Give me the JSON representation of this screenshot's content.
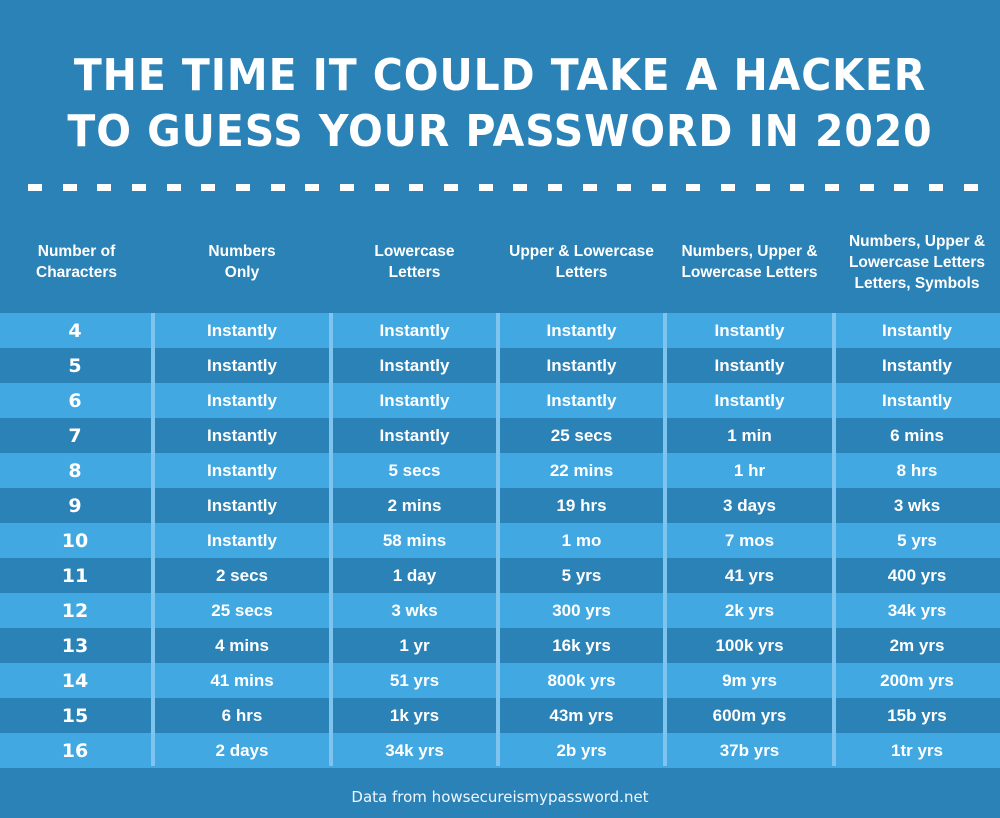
{
  "title_lines": [
    "THE TIME IT COULD TAKE A HACKER",
    "TO GUESS YOUR PASSWORD IN 2020"
  ],
  "footer": "Data from howsecureismypassword.net",
  "colors": {
    "background": "#2b82b6",
    "row_light": "#42a8e2",
    "row_dark": "#2b82b6",
    "divider": "#7ec4ef",
    "text": "#ffffff"
  },
  "chart_data": {
    "type": "table",
    "title": "THE TIME IT COULD TAKE A HACKER TO GUESS YOUR PASSWORD IN 2020",
    "columns": [
      "Number of Characters",
      "Numbers Only",
      "Lowercase Letters",
      "Upper & Lowercase Letters",
      "Numbers, Upper & Lowercase Letters",
      "Numbers, Upper & Lowercase Letters Letters, Symbols"
    ],
    "header_lines": [
      [
        "Number of",
        "Characters"
      ],
      [
        "Numbers",
        "Only"
      ],
      [
        "Lowercase",
        "Letters"
      ],
      [
        "Upper & Lowercase",
        "Letters"
      ],
      [
        "Numbers, Upper &",
        "Lowercase Letters"
      ],
      [
        "Numbers, Upper &",
        "Lowercase Letters",
        "Letters, Symbols"
      ]
    ],
    "rows": [
      [
        "4",
        "Instantly",
        "Instantly",
        "Instantly",
        "Instantly",
        "Instantly"
      ],
      [
        "5",
        "Instantly",
        "Instantly",
        "Instantly",
        "Instantly",
        "Instantly"
      ],
      [
        "6",
        "Instantly",
        "Instantly",
        "Instantly",
        "Instantly",
        "Instantly"
      ],
      [
        "7",
        "Instantly",
        "Instantly",
        "25 secs",
        "1 min",
        "6 mins"
      ],
      [
        "8",
        "Instantly",
        "5 secs",
        "22 mins",
        "1 hr",
        "8 hrs"
      ],
      [
        "9",
        "Instantly",
        "2 mins",
        "19 hrs",
        "3 days",
        "3 wks"
      ],
      [
        "10",
        "Instantly",
        "58 mins",
        "1 mo",
        "7 mos",
        "5 yrs"
      ],
      [
        "11",
        "2 secs",
        "1 day",
        "5 yrs",
        "41 yrs",
        "400 yrs"
      ],
      [
        "12",
        "25 secs",
        "3 wks",
        "300 yrs",
        "2k yrs",
        "34k yrs"
      ],
      [
        "13",
        "4 mins",
        "1 yr",
        "16k yrs",
        "100k yrs",
        "2m yrs"
      ],
      [
        "14",
        "41 mins",
        "51 yrs",
        "800k yrs",
        "9m yrs",
        "200m yrs"
      ],
      [
        "15",
        "6 hrs",
        "1k yrs",
        "43m yrs",
        "600m yrs",
        "15b yrs"
      ],
      [
        "16",
        "2 days",
        "34k yrs",
        "2b yrs",
        "37b yrs",
        "1tr yrs"
      ]
    ],
    "source": "Data from howsecureismypassword.net"
  }
}
